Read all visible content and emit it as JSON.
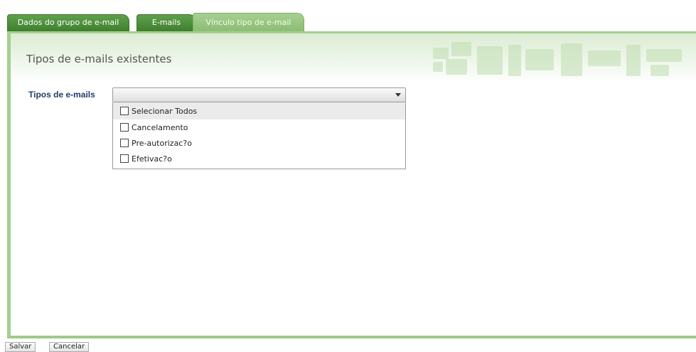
{
  "tabs": [
    {
      "label": "Dados do grupo de e-mail"
    },
    {
      "label": "E-mails"
    },
    {
      "label": "Vínculo tipo de e-mail"
    }
  ],
  "panel": {
    "title": "Tipos de e-mails existentes"
  },
  "field": {
    "label": "Tipos de e-mails",
    "selected_value": "",
    "options": [
      {
        "label": "Selecionar Todos",
        "checked": false
      },
      {
        "label": "Cancelamento",
        "checked": false
      },
      {
        "label": "Pre-autorizac?o",
        "checked": false
      },
      {
        "label": "Efetivac?o",
        "checked": false
      }
    ]
  },
  "buttons": {
    "save_label": "Salvar",
    "cancel_label": "Cancelar"
  },
  "colors": {
    "tab_green": "#3f7f2f",
    "tab_active": "#8bbd73",
    "label_blue": "#1f3f66"
  }
}
